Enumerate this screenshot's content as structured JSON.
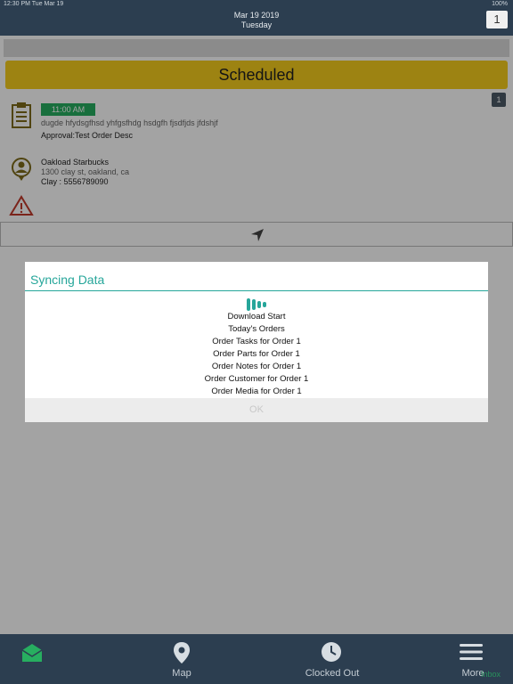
{
  "status_bar": {
    "time": "12:30 PM  Tue Mar 19",
    "battery": "100%"
  },
  "header": {
    "date": "Mar 19 2019",
    "weekday": "Tuesday",
    "badge": "1"
  },
  "order": {
    "status": "Scheduled",
    "count_badge": "1",
    "time": "11:00 AM",
    "description": "dugde hfydsgfhsd yhfgsfhdg hsdgfh fjsdfjds jfdshjf",
    "approval": "Approval:Test Order Desc",
    "customer_name": "Oakload Starbucks",
    "customer_address": "1300 clay st, oakland, ca",
    "customer_phone": "Clay : 5556789090"
  },
  "dialog": {
    "title": "Syncing Data",
    "items": [
      "Download Start",
      "Today's Orders",
      "Order Tasks for Order 1",
      "Order Parts for Order 1",
      "Order Notes for Order 1",
      "Order Customer for Order 1",
      "Order Media for Order 1"
    ],
    "ok_label": "OK"
  },
  "tabbar": {
    "inbox_label": "Inbox",
    "map_label": "Map",
    "clock_label": "Clocked Out",
    "more_label": "More"
  },
  "colors": {
    "header": "#2c3e50",
    "accent": "#26a69a",
    "scheduled": "#f6cd1d",
    "time_pill": "#27ae60",
    "icon_gold": "#7d6b1a",
    "warning": "#c0392b"
  },
  "icons": [
    "clipboard-icon",
    "location-person-icon",
    "warning-icon",
    "navigation-arrow-icon",
    "inbox-icon",
    "map-pin-icon",
    "clock-icon",
    "menu-icon",
    "loader-icon"
  ]
}
